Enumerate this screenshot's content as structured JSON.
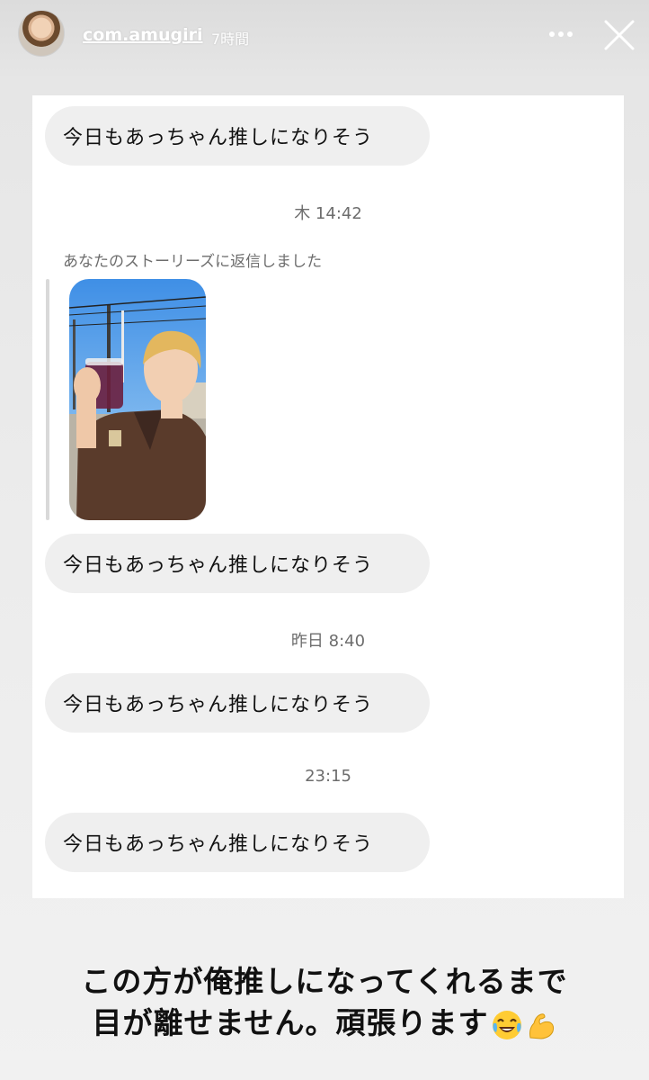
{
  "story_header": {
    "username": "com.amugiri",
    "time_ago": "7時間",
    "more_icon": "more-horizontal-icon",
    "close_icon": "close-icon"
  },
  "dm": {
    "messages": [
      {
        "text": "今日もあっちゃん推しになりそう"
      },
      {
        "timestamp": "木 14:42"
      },
      {
        "reply_note": "あなたのストーリーズに返信しました"
      },
      {
        "text": "今日もあっちゃん推しになりそう"
      },
      {
        "timestamp": "昨日 8:40"
      },
      {
        "text": "今日もあっちゃん推しになりそう"
      },
      {
        "timestamp": "23:15"
      },
      {
        "text": "今日もあっちゃん推しになりそう"
      }
    ]
  },
  "caption": {
    "line1": "この方が俺推しになってくれるまで",
    "line2": "目が離せません。頑張ります",
    "emojis": [
      "face-with-tears-of-joy",
      "flexed-biceps"
    ]
  }
}
